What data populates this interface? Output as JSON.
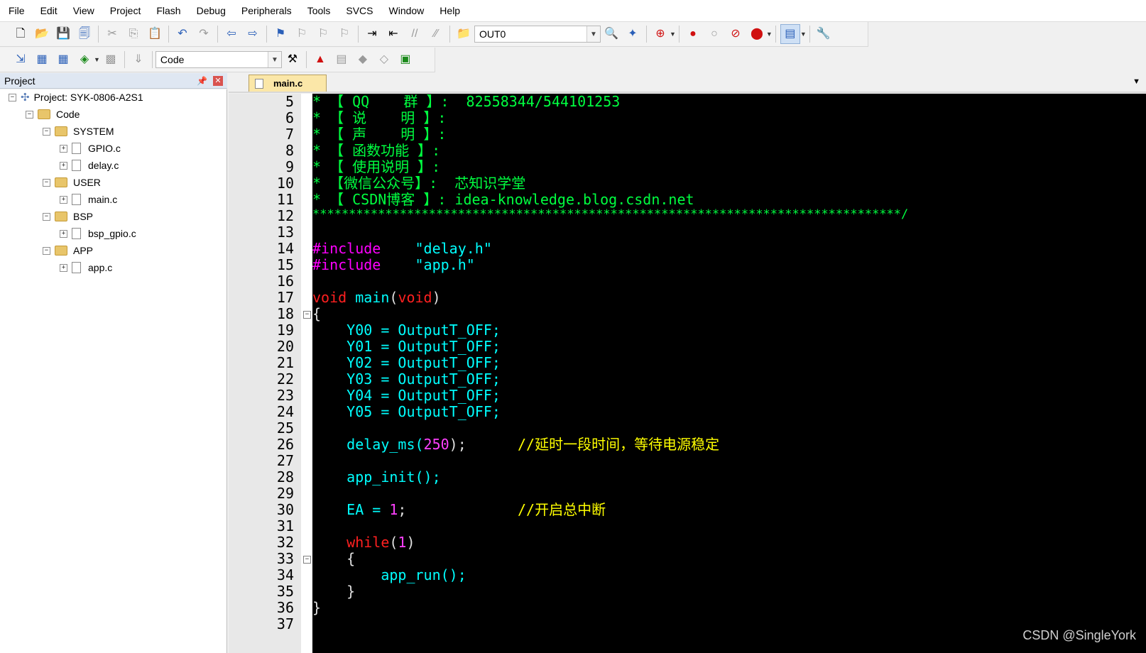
{
  "menu": [
    "File",
    "Edit",
    "View",
    "Project",
    "Flash",
    "Debug",
    "Peripherals",
    "Tools",
    "SVCS",
    "Window",
    "Help"
  ],
  "toolbar": {
    "find_value": "OUT0",
    "target_value": "Code"
  },
  "project": {
    "title": "Project",
    "tree": {
      "root": "Project: SYK-0806-A2S1",
      "group": "Code",
      "folders": [
        {
          "name": "SYSTEM",
          "files": [
            "GPIO.c",
            "delay.c"
          ]
        },
        {
          "name": "USER",
          "files": [
            "main.c"
          ]
        },
        {
          "name": "BSP",
          "files": [
            "bsp_gpio.c"
          ]
        },
        {
          "name": "APP",
          "files": [
            "app.c"
          ]
        }
      ]
    }
  },
  "editor": {
    "tab": "main.c",
    "line_numbers": [
      "5",
      "6",
      "7",
      "8",
      "9",
      "10",
      "11",
      "12",
      "13",
      "14",
      "15",
      "16",
      "17",
      "18",
      "19",
      "20",
      "21",
      "22",
      "23",
      "24",
      "25",
      "26",
      "27",
      "28",
      "29",
      "30",
      "31",
      "32",
      "33",
      "34",
      "35",
      "36",
      "37"
    ],
    "lines": {
      "l5": "* 【 QQ    群 】:  82558344/544101253",
      "l6": "* 【 说    明 】:",
      "l7": "* 【 声    明 】:",
      "l8": "* 【 函数功能 】:",
      "l9": "* 【 使用说明 】:",
      "l10": "* 【微信公众号】:  芯知识学堂",
      "l11": "* 【 CSDN博客 】: idea-knowledge.blog.csdn.net",
      "l12": "*********************************************************************************/",
      "inc_kw": "#include",
      "inc1": "\"delay.h\"",
      "inc2": "\"app.h\"",
      "void": "void",
      "main": " main",
      "paren_open": "(",
      "paren_close": ")",
      "brace_open": "{",
      "brace_close": "}",
      "assign": [
        "    Y00 = OutputT_OFF;",
        "    Y01 = OutputT_OFF;",
        "    Y02 = OutputT_OFF;",
        "    Y03 = OutputT_OFF;",
        "    Y04 = OutputT_OFF;",
        "    Y05 = OutputT_OFF;"
      ],
      "delay_fn": "    delay_ms(",
      "delay_arg": "250",
      "delay_end": ");      ",
      "delay_cmt": "//延时一段时间，等待电源稳定",
      "init": "    app_init();",
      "ea": "    EA = ",
      "ea_val": "1",
      "ea_end": ";             ",
      "ea_cmt": "//开启总中断",
      "while_kw": "    while",
      "while_open": "(",
      "while_arg": "1",
      "while_close": ")",
      "inner_open": "    {",
      "run": "        app_run();",
      "inner_close": "    }"
    }
  },
  "watermark": "CSDN @SingleYork"
}
